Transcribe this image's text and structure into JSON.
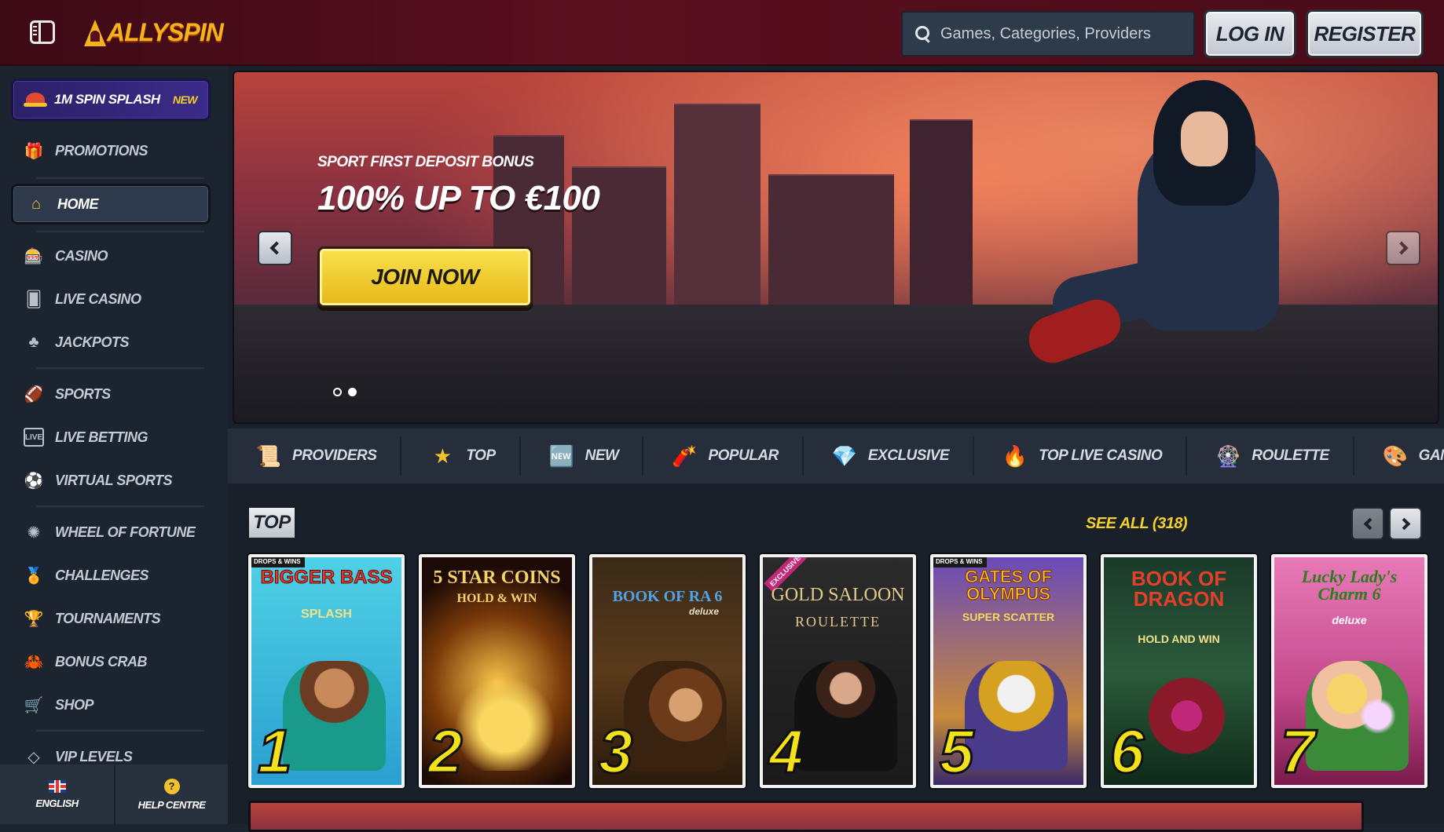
{
  "header": {
    "logo_text": "ALLYSPIN",
    "search_placeholder": "Games, Categories, Providers",
    "login_label": "LOG IN",
    "register_label": "REGISTER"
  },
  "sidebar": {
    "promo": {
      "label": "1M SPIN SPLASH",
      "badge": "NEW"
    },
    "items": [
      {
        "label": "PROMOTIONS",
        "icon": "gift-icon"
      },
      {
        "label": "HOME",
        "icon": "home-icon",
        "active": true
      },
      {
        "label": "CASINO",
        "icon": "slot-machine-icon"
      },
      {
        "label": "LIVE CASINO",
        "icon": "playing-card-icon"
      },
      {
        "label": "JACKPOTS",
        "icon": "clover-icon"
      },
      {
        "label": "SPORTS",
        "icon": "football-icon"
      },
      {
        "label": "LIVE BETTING",
        "icon": "live-badge-icon"
      },
      {
        "label": "VIRTUAL SPORTS",
        "icon": "virtual-ball-icon"
      },
      {
        "label": "WHEEL OF FORTUNE",
        "icon": "wheel-icon"
      },
      {
        "label": "CHALLENGES",
        "icon": "medal-icon"
      },
      {
        "label": "TOURNAMENTS",
        "icon": "trophy-icon"
      },
      {
        "label": "BONUS CRAB",
        "icon": "crab-claw-icon"
      },
      {
        "label": "SHOP",
        "icon": "cart-icon"
      },
      {
        "label": "VIP LEVELS",
        "icon": "diamond-icon"
      }
    ],
    "footer": {
      "language": "ENGLISH",
      "help": "HELP CENTRE",
      "help_glyph": "?"
    }
  },
  "hero": {
    "subtitle": "SPORT FIRST DEPOSIT BONUS",
    "title": "100% UP TO €100",
    "cta": "JOIN NOW",
    "slides": 2,
    "active_slide": 2
  },
  "categories": [
    {
      "label": "PROVIDERS",
      "icon": "scroll-icon",
      "glyph": "📜"
    },
    {
      "label": "TOP",
      "icon": "star-icon",
      "glyph": "★"
    },
    {
      "label": "NEW",
      "icon": "new-badge-icon",
      "glyph": "🆕"
    },
    {
      "label": "POPULAR",
      "icon": "dynamite-icon",
      "glyph": "🧨"
    },
    {
      "label": "EXCLUSIVE",
      "icon": "gem-icon",
      "glyph": "💎"
    },
    {
      "label": "TOP LIVE CASINO",
      "icon": "fire-icon",
      "glyph": "🔥"
    },
    {
      "label": "ROULETTE",
      "icon": "roulette-icon",
      "glyph": "🎡"
    },
    {
      "label": "GAME S",
      "icon": "game-shows-icon",
      "glyph": "🎨"
    }
  ],
  "top_section": {
    "title": "TOP",
    "see_all": "SEE ALL (318)",
    "games": [
      {
        "rank": "1",
        "title": "BIGGER BASS",
        "sub": "SPLASH",
        "badge": "DROPS & WINS"
      },
      {
        "rank": "2",
        "title": "5 STAR COINS",
        "sub": "HOLD & WIN",
        "badge": ""
      },
      {
        "rank": "3",
        "title": "BOOK OF RA 6",
        "sub": "deluxe",
        "badge": ""
      },
      {
        "rank": "4",
        "title": "GOLD SALOON",
        "sub": "ROULETTE",
        "badge": "EXCLUSIVE"
      },
      {
        "rank": "5",
        "title": "GATES OF OLYMPUS",
        "sub": "SUPER SCATTER",
        "badge": "DROPS & WINS"
      },
      {
        "rank": "6",
        "title": "BOOK of DRAGON",
        "sub": "HOLD AND WIN",
        "badge": ""
      },
      {
        "rank": "7",
        "title": "Lucky Lady's Charm 6",
        "sub": "deluxe",
        "badge": ""
      }
    ]
  }
}
